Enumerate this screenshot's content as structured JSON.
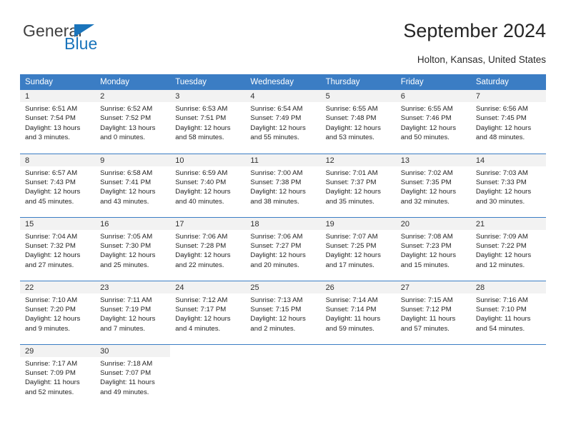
{
  "brand": {
    "name_top": "General",
    "name_bottom": "Blue",
    "triangle_icon": "blue-triangle-logo-mark",
    "accent_color": "#1a74bb",
    "gray_color": "#404040"
  },
  "header": {
    "title": "September 2024",
    "location": "Holton, Kansas, United States"
  },
  "theme": {
    "header_row_bg": "#3b7dc4",
    "header_row_text": "#ffffff",
    "daynum_band_bg": "#f2f2f2",
    "row_separator": "#3b7dc4",
    "body_text": "#242424"
  },
  "calendar": {
    "month": "September",
    "year": "2024",
    "weekday_headers": [
      "Sunday",
      "Monday",
      "Tuesday",
      "Wednesday",
      "Thursday",
      "Friday",
      "Saturday"
    ],
    "weeks": [
      [
        {
          "day": "1",
          "sunrise": "Sunrise: 6:51 AM",
          "sunset": "Sunset: 7:54 PM",
          "daylight_1": "Daylight: 13 hours",
          "daylight_2": "and 3 minutes."
        },
        {
          "day": "2",
          "sunrise": "Sunrise: 6:52 AM",
          "sunset": "Sunset: 7:52 PM",
          "daylight_1": "Daylight: 13 hours",
          "daylight_2": "and 0 minutes."
        },
        {
          "day": "3",
          "sunrise": "Sunrise: 6:53 AM",
          "sunset": "Sunset: 7:51 PM",
          "daylight_1": "Daylight: 12 hours",
          "daylight_2": "and 58 minutes."
        },
        {
          "day": "4",
          "sunrise": "Sunrise: 6:54 AM",
          "sunset": "Sunset: 7:49 PM",
          "daylight_1": "Daylight: 12 hours",
          "daylight_2": "and 55 minutes."
        },
        {
          "day": "5",
          "sunrise": "Sunrise: 6:55 AM",
          "sunset": "Sunset: 7:48 PM",
          "daylight_1": "Daylight: 12 hours",
          "daylight_2": "and 53 minutes."
        },
        {
          "day": "6",
          "sunrise": "Sunrise: 6:55 AM",
          "sunset": "Sunset: 7:46 PM",
          "daylight_1": "Daylight: 12 hours",
          "daylight_2": "and 50 minutes."
        },
        {
          "day": "7",
          "sunrise": "Sunrise: 6:56 AM",
          "sunset": "Sunset: 7:45 PM",
          "daylight_1": "Daylight: 12 hours",
          "daylight_2": "and 48 minutes."
        }
      ],
      [
        {
          "day": "8",
          "sunrise": "Sunrise: 6:57 AM",
          "sunset": "Sunset: 7:43 PM",
          "daylight_1": "Daylight: 12 hours",
          "daylight_2": "and 45 minutes."
        },
        {
          "day": "9",
          "sunrise": "Sunrise: 6:58 AM",
          "sunset": "Sunset: 7:41 PM",
          "daylight_1": "Daylight: 12 hours",
          "daylight_2": "and 43 minutes."
        },
        {
          "day": "10",
          "sunrise": "Sunrise: 6:59 AM",
          "sunset": "Sunset: 7:40 PM",
          "daylight_1": "Daylight: 12 hours",
          "daylight_2": "and 40 minutes."
        },
        {
          "day": "11",
          "sunrise": "Sunrise: 7:00 AM",
          "sunset": "Sunset: 7:38 PM",
          "daylight_1": "Daylight: 12 hours",
          "daylight_2": "and 38 minutes."
        },
        {
          "day": "12",
          "sunrise": "Sunrise: 7:01 AM",
          "sunset": "Sunset: 7:37 PM",
          "daylight_1": "Daylight: 12 hours",
          "daylight_2": "and 35 minutes."
        },
        {
          "day": "13",
          "sunrise": "Sunrise: 7:02 AM",
          "sunset": "Sunset: 7:35 PM",
          "daylight_1": "Daylight: 12 hours",
          "daylight_2": "and 32 minutes."
        },
        {
          "day": "14",
          "sunrise": "Sunrise: 7:03 AM",
          "sunset": "Sunset: 7:33 PM",
          "daylight_1": "Daylight: 12 hours",
          "daylight_2": "and 30 minutes."
        }
      ],
      [
        {
          "day": "15",
          "sunrise": "Sunrise: 7:04 AM",
          "sunset": "Sunset: 7:32 PM",
          "daylight_1": "Daylight: 12 hours",
          "daylight_2": "and 27 minutes."
        },
        {
          "day": "16",
          "sunrise": "Sunrise: 7:05 AM",
          "sunset": "Sunset: 7:30 PM",
          "daylight_1": "Daylight: 12 hours",
          "daylight_2": "and 25 minutes."
        },
        {
          "day": "17",
          "sunrise": "Sunrise: 7:06 AM",
          "sunset": "Sunset: 7:28 PM",
          "daylight_1": "Daylight: 12 hours",
          "daylight_2": "and 22 minutes."
        },
        {
          "day": "18",
          "sunrise": "Sunrise: 7:06 AM",
          "sunset": "Sunset: 7:27 PM",
          "daylight_1": "Daylight: 12 hours",
          "daylight_2": "and 20 minutes."
        },
        {
          "day": "19",
          "sunrise": "Sunrise: 7:07 AM",
          "sunset": "Sunset: 7:25 PM",
          "daylight_1": "Daylight: 12 hours",
          "daylight_2": "and 17 minutes."
        },
        {
          "day": "20",
          "sunrise": "Sunrise: 7:08 AM",
          "sunset": "Sunset: 7:23 PM",
          "daylight_1": "Daylight: 12 hours",
          "daylight_2": "and 15 minutes."
        },
        {
          "day": "21",
          "sunrise": "Sunrise: 7:09 AM",
          "sunset": "Sunset: 7:22 PM",
          "daylight_1": "Daylight: 12 hours",
          "daylight_2": "and 12 minutes."
        }
      ],
      [
        {
          "day": "22",
          "sunrise": "Sunrise: 7:10 AM",
          "sunset": "Sunset: 7:20 PM",
          "daylight_1": "Daylight: 12 hours",
          "daylight_2": "and 9 minutes."
        },
        {
          "day": "23",
          "sunrise": "Sunrise: 7:11 AM",
          "sunset": "Sunset: 7:19 PM",
          "daylight_1": "Daylight: 12 hours",
          "daylight_2": "and 7 minutes."
        },
        {
          "day": "24",
          "sunrise": "Sunrise: 7:12 AM",
          "sunset": "Sunset: 7:17 PM",
          "daylight_1": "Daylight: 12 hours",
          "daylight_2": "and 4 minutes."
        },
        {
          "day": "25",
          "sunrise": "Sunrise: 7:13 AM",
          "sunset": "Sunset: 7:15 PM",
          "daylight_1": "Daylight: 12 hours",
          "daylight_2": "and 2 minutes."
        },
        {
          "day": "26",
          "sunrise": "Sunrise: 7:14 AM",
          "sunset": "Sunset: 7:14 PM",
          "daylight_1": "Daylight: 11 hours",
          "daylight_2": "and 59 minutes."
        },
        {
          "day": "27",
          "sunrise": "Sunrise: 7:15 AM",
          "sunset": "Sunset: 7:12 PM",
          "daylight_1": "Daylight: 11 hours",
          "daylight_2": "and 57 minutes."
        },
        {
          "day": "28",
          "sunrise": "Sunrise: 7:16 AM",
          "sunset": "Sunset: 7:10 PM",
          "daylight_1": "Daylight: 11 hours",
          "daylight_2": "and 54 minutes."
        }
      ],
      [
        {
          "day": "29",
          "sunrise": "Sunrise: 7:17 AM",
          "sunset": "Sunset: 7:09 PM",
          "daylight_1": "Daylight: 11 hours",
          "daylight_2": "and 52 minutes."
        },
        {
          "day": "30",
          "sunrise": "Sunrise: 7:18 AM",
          "sunset": "Sunset: 7:07 PM",
          "daylight_1": "Daylight: 11 hours",
          "daylight_2": "and 49 minutes."
        },
        {
          "day": "",
          "sunrise": "",
          "sunset": "",
          "daylight_1": "",
          "daylight_2": ""
        },
        {
          "day": "",
          "sunrise": "",
          "sunset": "",
          "daylight_1": "",
          "daylight_2": ""
        },
        {
          "day": "",
          "sunrise": "",
          "sunset": "",
          "daylight_1": "",
          "daylight_2": ""
        },
        {
          "day": "",
          "sunrise": "",
          "sunset": "",
          "daylight_1": "",
          "daylight_2": ""
        },
        {
          "day": "",
          "sunrise": "",
          "sunset": "",
          "daylight_1": "",
          "daylight_2": ""
        }
      ]
    ]
  }
}
